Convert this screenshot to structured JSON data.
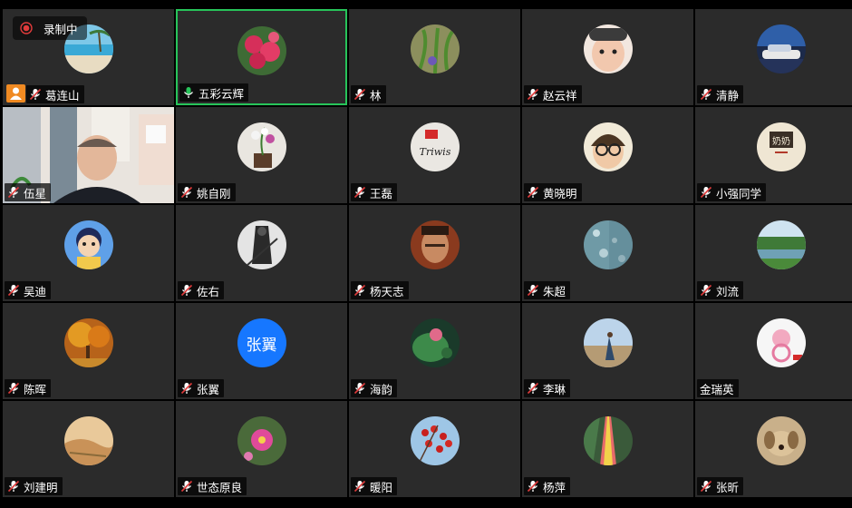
{
  "recording": {
    "label": "录制中",
    "color": "#e03b3b"
  },
  "accent": {
    "active_border": "#27c45a",
    "mic_active": "#27c45a",
    "host_badge": "#f08a22",
    "text_avatar_bg": "#1677ff"
  },
  "participants": [
    {
      "name": "葛连山",
      "avatar": "beach-photo",
      "host": true,
      "mic": "muted"
    },
    {
      "name": "五彩云辉",
      "avatar": "pink-roses-photo",
      "mic": "active",
      "speaking": true
    },
    {
      "name": "林",
      "avatar": "plant-photo",
      "mic": "muted"
    },
    {
      "name": "赵云祥",
      "avatar": "baby-photo",
      "mic": "muted"
    },
    {
      "name": "清静",
      "avatar": "car-photo",
      "mic": "muted"
    },
    {
      "name": "伍星",
      "avatar": "camera-video",
      "mic": "muted",
      "video": true
    },
    {
      "name": "姚自刚",
      "avatar": "orchid-photo",
      "mic": "muted"
    },
    {
      "name": "王磊",
      "avatar": "flag-logo",
      "mic": "muted"
    },
    {
      "name": "黄晓明",
      "avatar": "child-glasses-photo",
      "mic": "muted"
    },
    {
      "name": "小强同学",
      "avatar": "calligraphy-image",
      "mic": "muted"
    },
    {
      "name": "吴迪",
      "avatar": "cartoon-boy",
      "mic": "muted"
    },
    {
      "name": "佐右",
      "avatar": "warrior-art",
      "mic": "muted"
    },
    {
      "name": "杨天志",
      "avatar": "face-photo",
      "mic": "muted"
    },
    {
      "name": "朱超",
      "avatar": "rain-glass-photo",
      "mic": "muted"
    },
    {
      "name": "刘流",
      "avatar": "lake-landscape-photo",
      "mic": "muted"
    },
    {
      "name": "陈晖",
      "avatar": "autumn-tree-photo",
      "mic": "muted"
    },
    {
      "name": "张翼",
      "avatar": "text-avatar",
      "avatar_text": "张翼",
      "mic": "muted"
    },
    {
      "name": "海韵",
      "avatar": "lotus-photo",
      "mic": "muted"
    },
    {
      "name": "李琳",
      "avatar": "person-landscape-photo",
      "mic": "muted"
    },
    {
      "name": "金瑞英",
      "avatar": "flower-ring-photo",
      "mic": "none"
    },
    {
      "name": "刘建明",
      "avatar": "desert-photo",
      "mic": "muted"
    },
    {
      "name": "世态原良",
      "avatar": "pink-flower-photo",
      "mic": "muted"
    },
    {
      "name": "暖阳",
      "avatar": "red-berries-photo",
      "mic": "muted"
    },
    {
      "name": "杨萍",
      "avatar": "rainbow-road-photo",
      "mic": "muted"
    },
    {
      "name": "张昕",
      "avatar": "dog-photo",
      "mic": "muted"
    }
  ]
}
